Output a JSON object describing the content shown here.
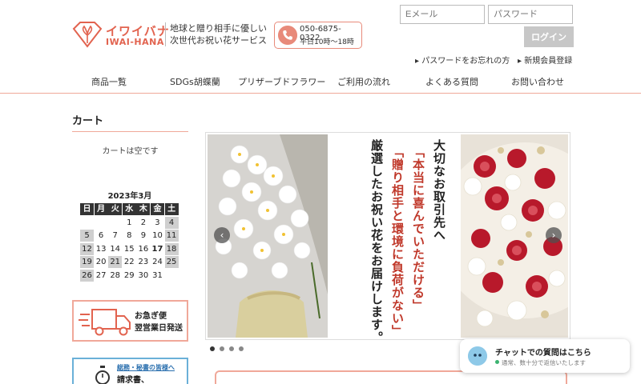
{
  "logo": {
    "jp": "イワイバナ",
    "en": "IWAI-HANA"
  },
  "tagline": {
    "line1": "地球と贈り相手に優しい",
    "line2": "次世代お祝い花サービス"
  },
  "phone": {
    "number": "050-6875-0322",
    "hours": "平日10時〜18時"
  },
  "login": {
    "email_placeholder": "Eメール",
    "password_placeholder": "パスワード",
    "button": "ログイン",
    "forgot": "パスワードをお忘れの方",
    "register": "新規会員登録"
  },
  "nav": [
    "商品一覧",
    "SDGs胡蝶蘭",
    "プリザーブドフラワー",
    "ご利用の流れ",
    "よくある質問",
    "お問い合わせ"
  ],
  "cart": {
    "title": "カート",
    "empty": "カートは空です"
  },
  "calendar": {
    "title": "2023年3月",
    "weekdays": [
      "日",
      "月",
      "火",
      "水",
      "木",
      "金",
      "土"
    ],
    "weeks": [
      [
        "",
        "",
        "",
        "1",
        "2",
        "3",
        "4"
      ],
      [
        "5",
        "6",
        "7",
        "8",
        "9",
        "10",
        "11"
      ],
      [
        "12",
        "13",
        "14",
        "15",
        "16",
        "17",
        "18"
      ],
      [
        "19",
        "20",
        "21",
        "22",
        "23",
        "24",
        "25"
      ],
      [
        "26",
        "27",
        "28",
        "29",
        "30",
        "31",
        ""
      ]
    ],
    "off_days": [
      "4",
      "5",
      "11",
      "12",
      "18",
      "19",
      "21",
      "25",
      "26"
    ],
    "today": "17"
  },
  "banners": {
    "express_line1": "お急ぎ便",
    "express_line2": "翌営業日発送",
    "invoice_line1": "総務・秘書の皆様へ",
    "invoice_line2": "請求書、"
  },
  "slider": {
    "text_col1": "大切なお取引先へ",
    "text_col2": "「本当に喜んでいただける」",
    "text_col3": "「贈り相手と環境に負荷がない」",
    "text_col4": "厳選したお祝い花をお届けします。",
    "prev": "‹",
    "next": "›",
    "dot_count": 4,
    "active_dot": 0
  },
  "chat": {
    "title": "チャットでの質問はこちら",
    "status": "通常、数十分で返信いたします"
  },
  "colors": {
    "accent": "#e2634f",
    "accent_light": "#f0a899",
    "text_red": "#c0392b"
  }
}
